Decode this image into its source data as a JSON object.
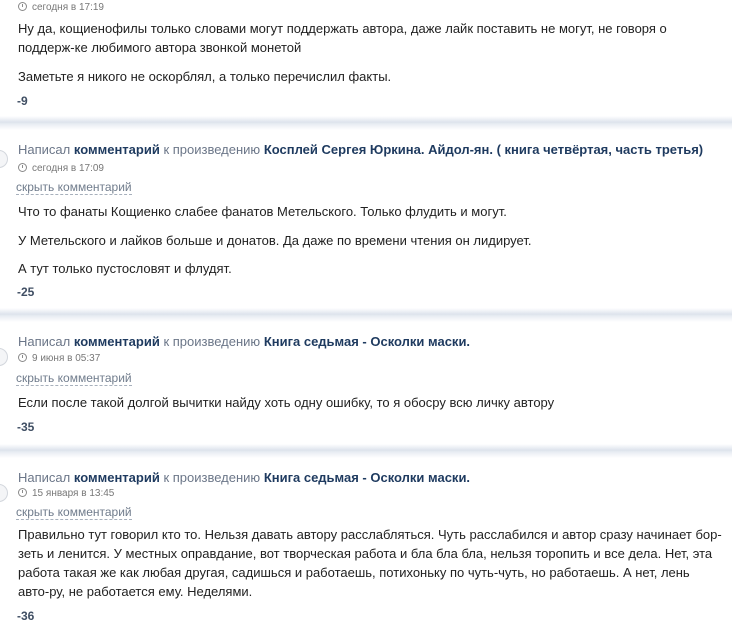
{
  "comments": [
    {
      "date": "сегодня в 17:19",
      "paragraphs": [
        "Ну да, кощиенофилы только словами могут поддержать автора, даже лайк поставить не могут, не говоря о поддерж-ке любимого автора звонкой монетой",
        "Заметьте я никого не оскорблял, а только перечислил факты."
      ],
      "rating": "-9"
    },
    {
      "header": {
        "prefix": "Написал",
        "comment_word": "комментарий",
        "middle": "к произведению",
        "work": "Косплей Сергея Юркина. Айдол-ян. ( книга четвёртая, часть третья)"
      },
      "date": "сегодня в 17:09",
      "hide_label": "скрыть комментарий",
      "paragraphs": [
        "Что то фанаты Кощиенко слабее фанатов Метельского. Только флудить и могут.",
        "У Метельского и лайков больше и донатов. Да даже по времени чтения он лидирует.",
        "А тут только пустословят и флудят."
      ],
      "rating": "-25"
    },
    {
      "header": {
        "prefix": "Написал",
        "comment_word": "комментарий",
        "middle": "к произведению",
        "work": "Книга седьмая - Осколки маски."
      },
      "date": "9 июня в 05:37",
      "hide_label": "скрыть комментарий",
      "paragraphs": [
        "Если после такой долгой вычитки найду хоть одну ошибку, то я обосру всю личку автору"
      ],
      "rating": "-35"
    },
    {
      "header": {
        "prefix": "Написал",
        "comment_word": "комментарий",
        "middle": "к произведению",
        "work": "Книга седьмая - Осколки маски."
      },
      "date": "15 января в 13:45",
      "hide_label": "скрыть комментарий",
      "paragraphs": [
        "Правильно тут говорил кто то. Нельзя давать автору расслабляться. Чуть расслабился и автор сразу начинает бор-зеть и ленится. У местных оправдание, вот творческая работа и бла бла бла, нельзя торопить и все дела. Нет, эта работа такая же как любая другая, садишься и работаешь, потихоньку по чуть-чуть, но работаешь. А нет, лень авто-ру, не работается ему. Неделями."
      ],
      "rating": "-36"
    }
  ]
}
